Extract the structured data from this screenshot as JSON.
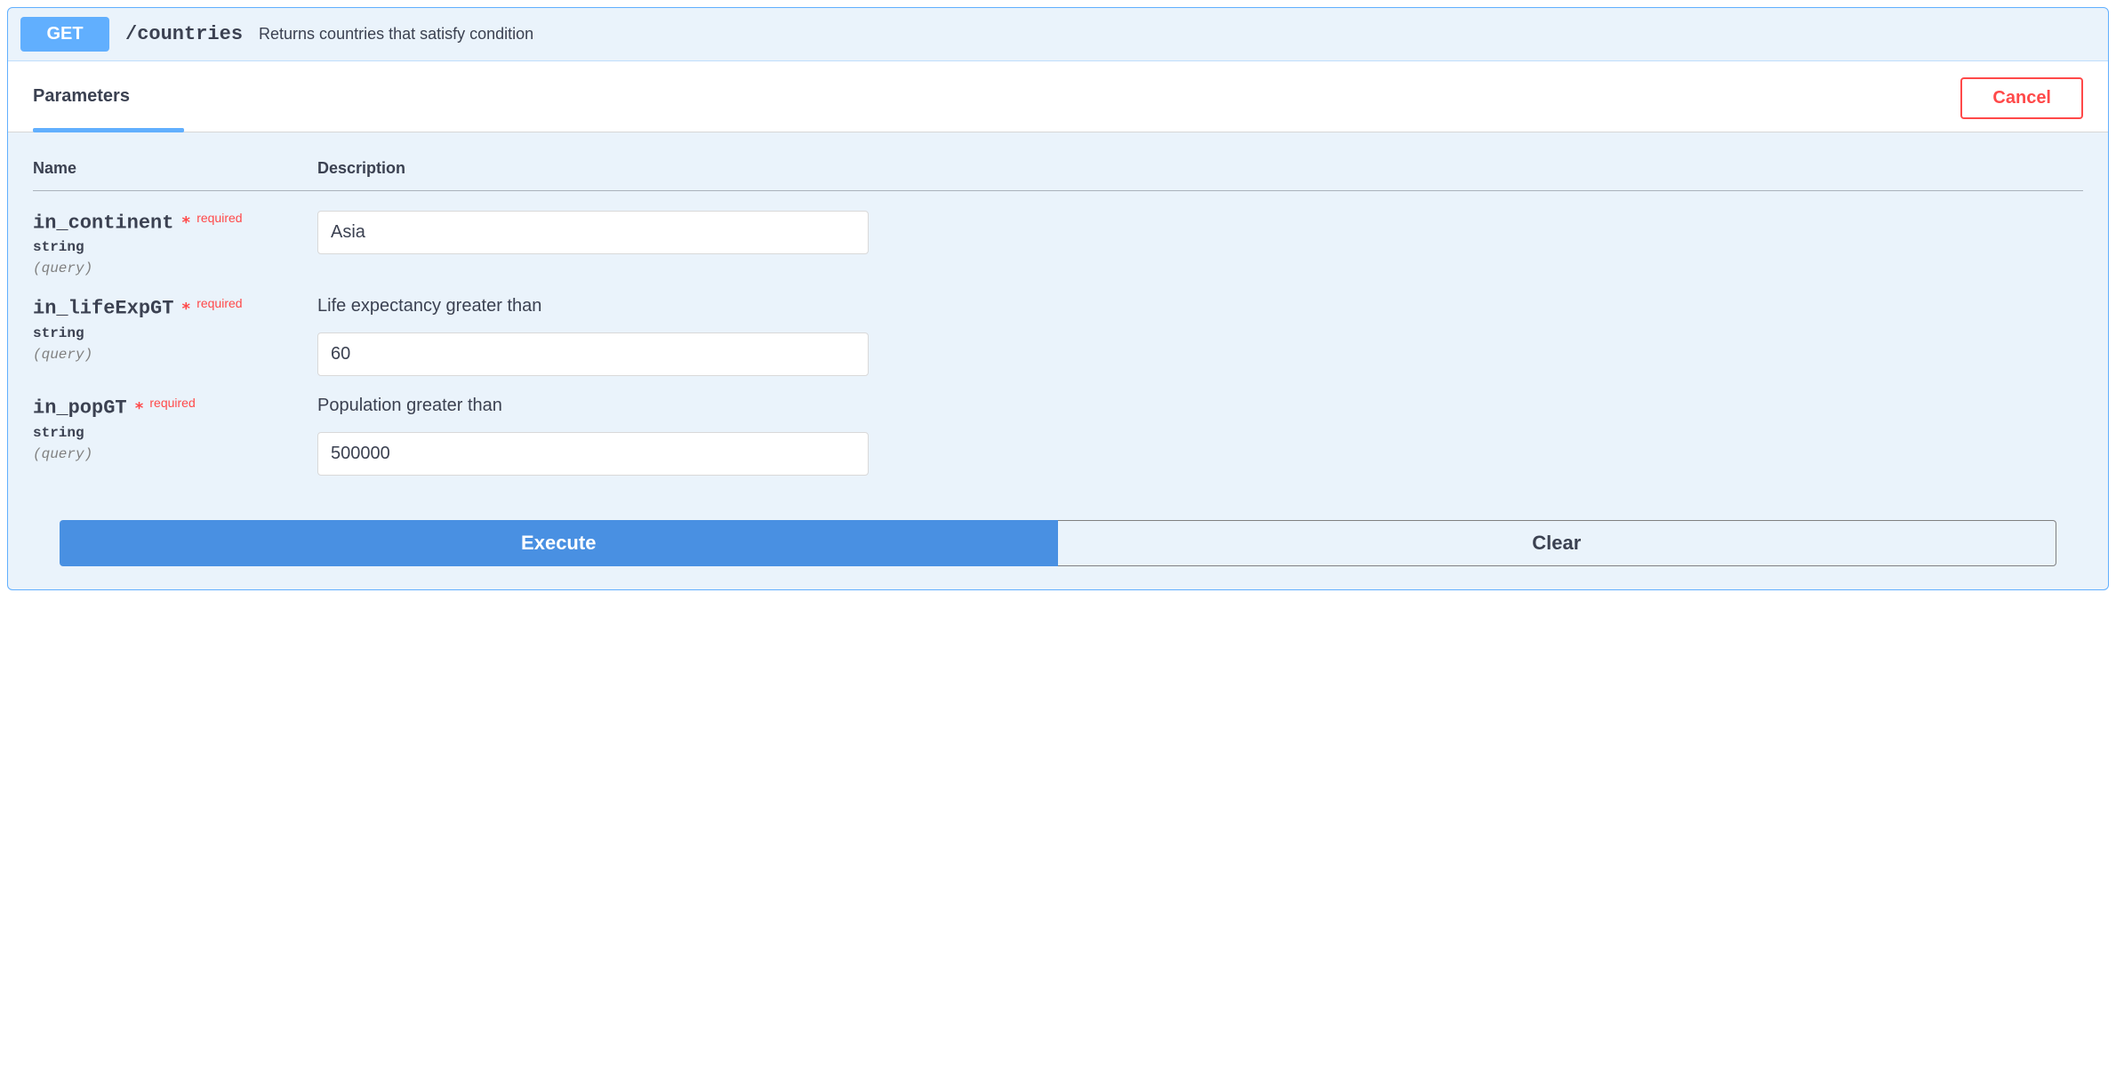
{
  "operation": {
    "method": "GET",
    "path": "/countries",
    "summary": "Returns countries that satisfy condition"
  },
  "section": {
    "tab": "Parameters",
    "cancel": "Cancel"
  },
  "columns": {
    "name": "Name",
    "description": "Description"
  },
  "required_star": "*",
  "required_label": "required",
  "params": [
    {
      "name": "in_continent",
      "type": "string",
      "in": "(query)",
      "description": "",
      "value": "Asia"
    },
    {
      "name": "in_lifeExpGT",
      "type": "string",
      "in": "(query)",
      "description": "Life expectancy greater than",
      "value": "60"
    },
    {
      "name": "in_popGT",
      "type": "string",
      "in": "(query)",
      "description": "Population greater than",
      "value": "500000"
    }
  ],
  "actions": {
    "execute": "Execute",
    "clear": "Clear"
  }
}
